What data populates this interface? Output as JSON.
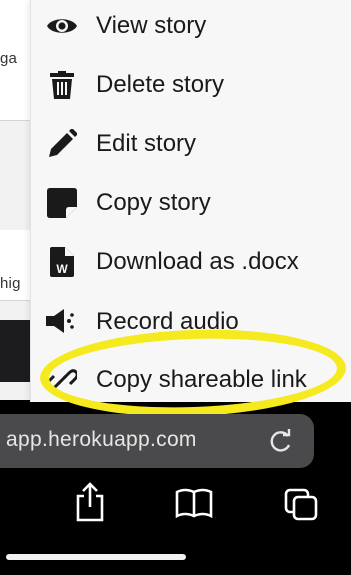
{
  "background_page": {
    "snippets": [
      "ga",
      "hig"
    ]
  },
  "menu": {
    "items": [
      {
        "label": "View story",
        "icon": "eye-icon"
      },
      {
        "label": "Delete story",
        "icon": "trash-icon"
      },
      {
        "label": "Edit story",
        "icon": "pencil-icon"
      },
      {
        "label": "Copy story",
        "icon": "copy-note-icon"
      },
      {
        "label": "Download as .docx",
        "icon": "word-doc-icon"
      },
      {
        "label": "Record audio",
        "icon": "speaker-icon"
      },
      {
        "label": "Copy shareable link",
        "icon": "link-icon"
      }
    ]
  },
  "browser": {
    "url": "app.herokuapp.com",
    "toolbar": [
      "share-icon",
      "bookmarks-icon",
      "tabs-icon"
    ]
  },
  "colors": {
    "highlight": "#f5ea1f",
    "menu_bg": "#f7f7f8",
    "url_pill": "#4a4a4c"
  }
}
